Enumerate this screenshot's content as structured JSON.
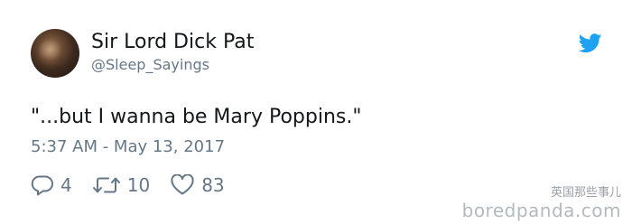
{
  "user": {
    "display_name": "Sir Lord Dick Pat",
    "handle": "@Sleep_Sayings"
  },
  "tweet": {
    "text": "\"...but I wanna be Mary Poppins.\"",
    "timestamp": "5:37 AM - May 13, 2017"
  },
  "actions": {
    "reply_icon": "reply-icon",
    "reply_count": "4",
    "retweet_icon": "retweet-icon",
    "retweet_count": "10",
    "like_icon": "heart-icon",
    "like_count": "83"
  },
  "branding": {
    "icon": "twitter-bird-icon",
    "color": "#1da1f2"
  },
  "watermark": {
    "caption": "英国那些事儿",
    "site": "boredpanda.com"
  },
  "colors": {
    "text_primary": "#14171a",
    "text_secondary": "#657786",
    "background": "#ffffff"
  }
}
